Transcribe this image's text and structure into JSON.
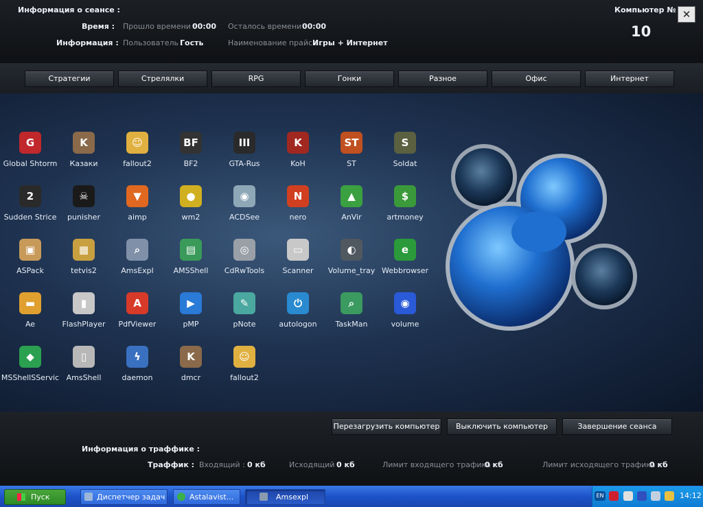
{
  "header": {
    "session_info": "Информация о сеансе :",
    "time_label": "Время :",
    "elapsed_label": "Прошло времени :",
    "elapsed_value": "00:00",
    "remaining_label": "Осталось времени :",
    "remaining_value": "00:00",
    "info_label": "Информация :",
    "user_label": "Пользователь :",
    "user_value": "Гость",
    "price_label": "Наименование прайса :",
    "price_value": "Игры + Интернет",
    "computer_label": "Компьютер №",
    "computer_number": "10",
    "close_symbol": "✕"
  },
  "categories": [
    "Стратегии",
    "Стрелялки",
    "RPG",
    "Гонки",
    "Разное",
    "Офис",
    "Интернет"
  ],
  "apps": [
    {
      "name": "Global Shtorm",
      "icon": "global-shtorm-icon",
      "color": "#c0282c",
      "glyph": "G"
    },
    {
      "name": "Казаки",
      "icon": "cossacks-icon",
      "color": "#8a6a4a",
      "glyph": "K"
    },
    {
      "name": "fallout2",
      "icon": "vault-boy-icon",
      "color": "#e0b040",
      "glyph": "☺"
    },
    {
      "name": "BF2",
      "icon": "battlefield-icon",
      "color": "#333333",
      "glyph": "BF"
    },
    {
      "name": "GTA-Rus",
      "icon": "gta-icon",
      "color": "#2a2a2a",
      "glyph": "III"
    },
    {
      "name": "KoH",
      "icon": "koh-icon",
      "color": "#a02820",
      "glyph": "K"
    },
    {
      "name": "ST",
      "icon": "st-icon",
      "color": "#c05020",
      "glyph": "ST"
    },
    {
      "name": "Soldat",
      "icon": "soldat-icon",
      "color": "#5a6040",
      "glyph": "S"
    },
    {
      "name": "Sudden Strice",
      "icon": "sudden-strike-icon",
      "color": "#2a2a2a",
      "glyph": "2"
    },
    {
      "name": "punisher",
      "icon": "punisher-icon",
      "color": "#1a1a1a",
      "glyph": "☠"
    },
    {
      "name": "aimp",
      "icon": "aimp-icon",
      "color": "#e06820",
      "glyph": "▼"
    },
    {
      "name": "wm2",
      "icon": "wm2-icon",
      "color": "#d0b020",
      "glyph": "●"
    },
    {
      "name": "ACDSee",
      "icon": "acdsee-icon",
      "color": "#8fa8b8",
      "glyph": "◉"
    },
    {
      "name": "nero",
      "icon": "nero-icon",
      "color": "#d04020",
      "glyph": "N"
    },
    {
      "name": "AnVir",
      "icon": "anvir-icon",
      "color": "#3aa040",
      "glyph": "▲"
    },
    {
      "name": "artmoney",
      "icon": "artmoney-icon",
      "color": "#3a9a3a",
      "glyph": "$"
    },
    {
      "name": "ASPack",
      "icon": "aspack-icon",
      "color": "#c89a5a",
      "glyph": "▣"
    },
    {
      "name": "tetvis2",
      "icon": "tetris-icon",
      "color": "#c8a040",
      "glyph": "▦"
    },
    {
      "name": "AmsExpl",
      "icon": "magnifier-icon",
      "color": "#8090a8",
      "glyph": "⌕"
    },
    {
      "name": "AMSShell",
      "icon": "cubes-icon",
      "color": "#3a9a5a",
      "glyph": "▤"
    },
    {
      "name": "CdRwTools",
      "icon": "cd-icon",
      "color": "#9aa0a8",
      "glyph": "◎"
    },
    {
      "name": "Scanner",
      "icon": "scanner-icon",
      "color": "#c8c8c8",
      "glyph": "▭"
    },
    {
      "name": "Volume_tray",
      "icon": "speaker-icon",
      "color": "#505860",
      "glyph": "◐"
    },
    {
      "name": "Webbrowser",
      "icon": "ie-icon",
      "color": "#2a9a3a",
      "glyph": "e"
    },
    {
      "name": "Ae",
      "icon": "folder-icon",
      "color": "#e0a030",
      "glyph": "▬"
    },
    {
      "name": "FlashPlayer",
      "icon": "film-icon",
      "color": "#c8c8c8",
      "glyph": "▮"
    },
    {
      "name": "PdfViewer",
      "icon": "pdf-icon",
      "color": "#d83a2a",
      "glyph": "A"
    },
    {
      "name": "pMP",
      "icon": "media-player-icon",
      "color": "#2a7ad8",
      "glyph": "▶"
    },
    {
      "name": "pNote",
      "icon": "notepad-icon",
      "color": "#4aa8a0",
      "glyph": "✎"
    },
    {
      "name": "autologon",
      "icon": "power-icon",
      "color": "#2a8ad0",
      "glyph": "⏻"
    },
    {
      "name": "TaskMan",
      "icon": "task-search-icon",
      "color": "#3a9a60",
      "glyph": "⌕"
    },
    {
      "name": "volume",
      "icon": "disc-icon",
      "color": "#2a5ad8",
      "glyph": "◉"
    },
    {
      "name": "MSShellSServic",
      "icon": "shield-icon",
      "color": "#2aa050",
      "glyph": "◆"
    },
    {
      "name": "AmsShell",
      "icon": "pc-tower-icon",
      "color": "#b8b8b8",
      "glyph": "▯"
    },
    {
      "name": "daemon",
      "icon": "daemon-icon",
      "color": "#3a70c0",
      "glyph": "ϟ"
    },
    {
      "name": "dmcr",
      "icon": "dmcr-icon",
      "color": "#8a6a4a",
      "glyph": "K"
    },
    {
      "name": "fallout2",
      "icon": "vault-boy-icon",
      "color": "#e0b040",
      "glyph": "☺"
    }
  ],
  "actions": {
    "restart": "Перезагрузить компьютер",
    "shutdown": "Выключить компьютер",
    "end_session": "Завершение сеанса"
  },
  "traffic": {
    "title": "Информация о траффике :",
    "label": "Траффик :",
    "incoming_label": "Входящий :",
    "incoming_value": "0 кб",
    "outgoing_label": "Исходящий :",
    "outgoing_value": "0 кб",
    "in_limit_label": "Лимит входящего трафика :",
    "in_limit_value": "0 кб",
    "out_limit_label": "Лимит исходящего трафика :",
    "out_limit_value": "0 кб"
  },
  "taskbar": {
    "start": "Пуск",
    "tasks": [
      "Диспетчер задач",
      "Astalavist...",
      "Amsexpl"
    ],
    "lang": "EN",
    "clock": "14:12"
  }
}
